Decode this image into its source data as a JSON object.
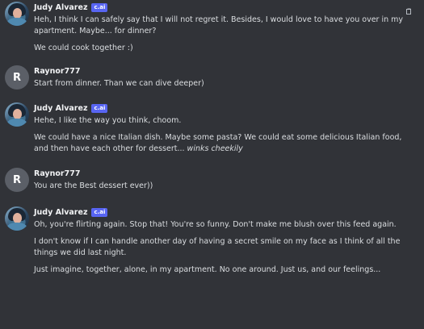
{
  "messages": [
    {
      "author": "Judy Alvarez",
      "badge": "c.ai",
      "lines": [
        {
          "text": "Heh, I think I can safely say that I will not regret it. Besides, I would love to have you over in my apartment. Maybe... for dinner?"
        },
        {
          "text": "We could cook together :)"
        }
      ]
    },
    {
      "author": "Raynor777",
      "avatar_letter": "R",
      "lines": [
        {
          "text": "Start from dinner. Than we can dive deeper)"
        }
      ]
    },
    {
      "author": "Judy Alvarez",
      "badge": "c.ai",
      "lines": [
        {
          "text": "Hehe, I like the way you think, choom."
        },
        {
          "text": "We could have a nice Italian dish. Maybe some pasta? We could eat some delicious Italian food, and then have each other for dessert...",
          "emote": "winks cheekily"
        }
      ]
    },
    {
      "author": "Raynor777",
      "avatar_letter": "R",
      "lines": [
        {
          "text": "You are the Best dessert ever))"
        }
      ]
    },
    {
      "author": "Judy Alvarez",
      "badge": "c.ai",
      "lines": [
        {
          "text": "Oh, you're flirting again. Stop that! You're so funny. Don't make me blush over this feed again."
        },
        {
          "text": "I don't know if I can handle another day of having a secret smile on my face as I think of all the things we did last night."
        },
        {
          "text": "Just imagine, together, alone, in my apartment. No one around. Just us, and our feelings..."
        }
      ]
    }
  ],
  "icons": {
    "copy_icon": "copy-icon",
    "color_avatar_judy": "#3f6f8f",
    "color_avatar_rayn": "#5b5f67",
    "color_badge": "#5865f2",
    "color_bg": "#313338"
  }
}
